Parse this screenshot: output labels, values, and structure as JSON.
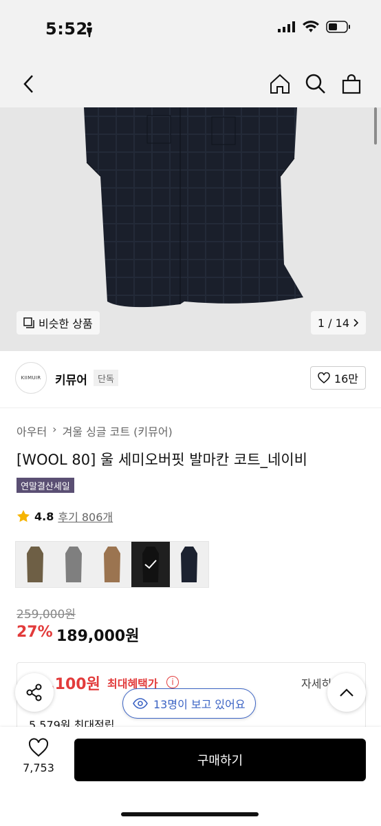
{
  "status": {
    "time": "5:52"
  },
  "nav": {},
  "hero": {
    "similar_label": "비슷한 상품",
    "counter": "1 / 14"
  },
  "brand": {
    "logo_text": "KIIMUIR",
    "name": "키뮤어",
    "tag": "단독",
    "likes": "16만"
  },
  "product": {
    "breadcrumb": [
      "아우터",
      "겨울 싱글 코트 (키뮤어)"
    ],
    "title": "[WOOL 80] 울 세미오버핏 발마칸 코트_네이비",
    "badge": "연말결산세일",
    "rating": "4.8",
    "reviews": "후기 806개",
    "swatches": [
      {
        "color": "#6e5f45"
      },
      {
        "color": "#7f7f7f"
      },
      {
        "color": "#9b7450"
      },
      {
        "color": "#1f1f1f"
      },
      {
        "color": "#1c2230"
      }
    ],
    "original_price": "259,000원",
    "discount": "27%",
    "price": "189,000원"
  },
  "benefit": {
    "price": "0,100원",
    "label": "최대혜택가",
    "detail": "자세히",
    "points": "5,579원 최대적립"
  },
  "viewers": "13명이 보고 있어요",
  "bottom": {
    "wishlist_count": "7,753",
    "buy_label": "구매하기"
  },
  "colors": {
    "accent_red": "#e23b3b",
    "badge_purple": "#5a4f73",
    "viewer_blue": "#3b63c4"
  }
}
